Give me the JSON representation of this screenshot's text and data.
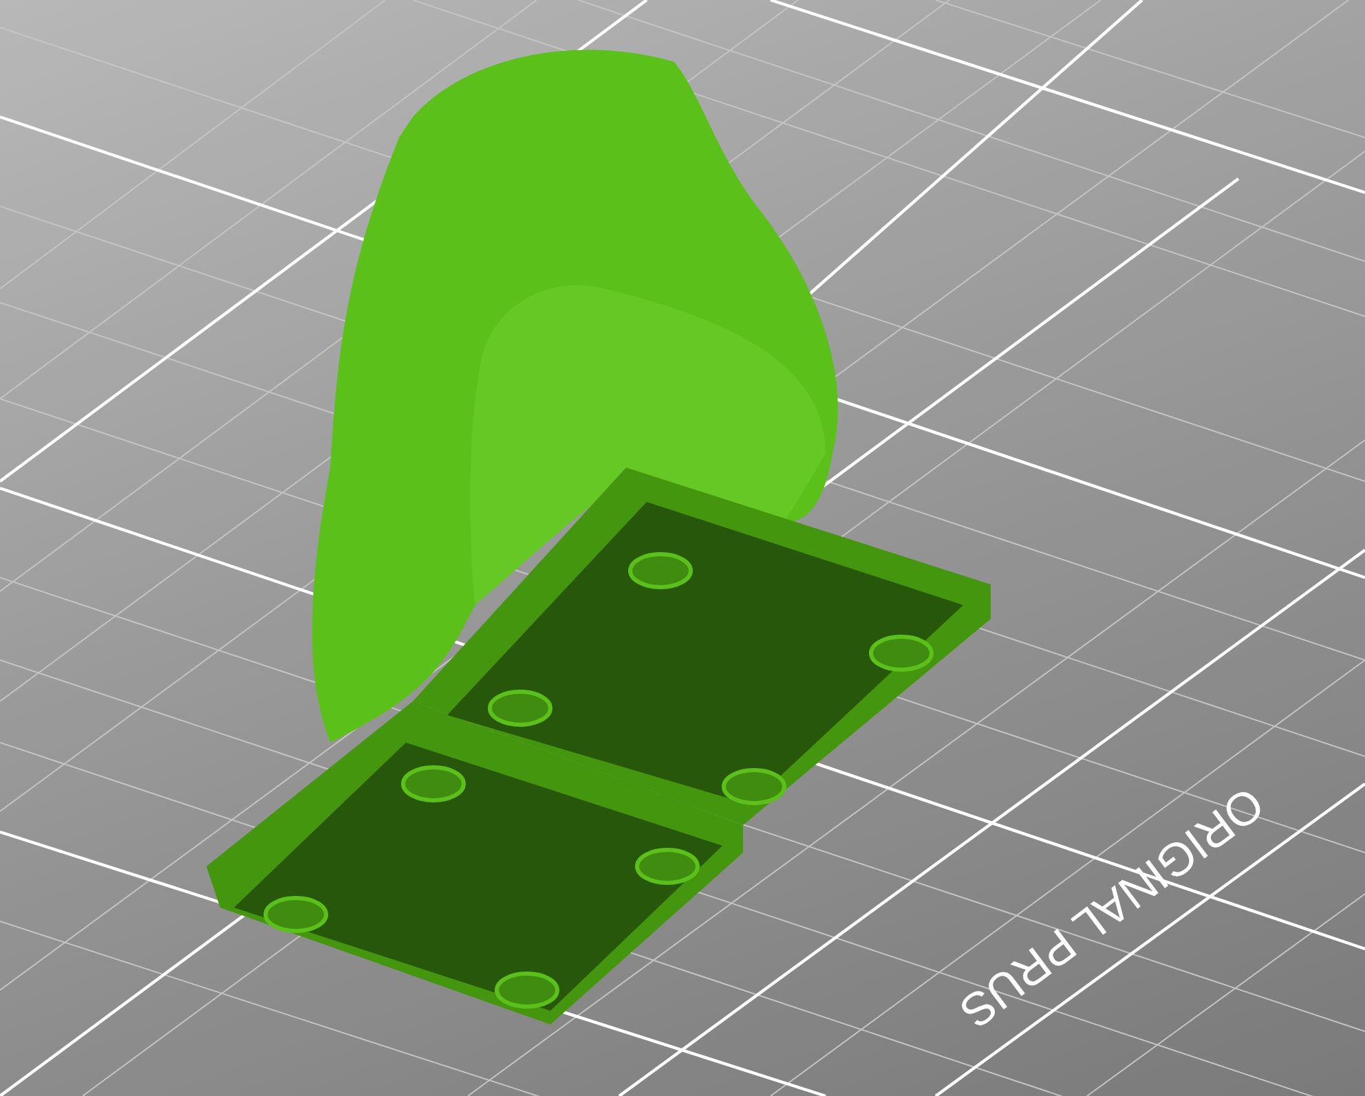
{
  "viewport": {
    "bed_label": "ORIGINAL PRUS"
  }
}
